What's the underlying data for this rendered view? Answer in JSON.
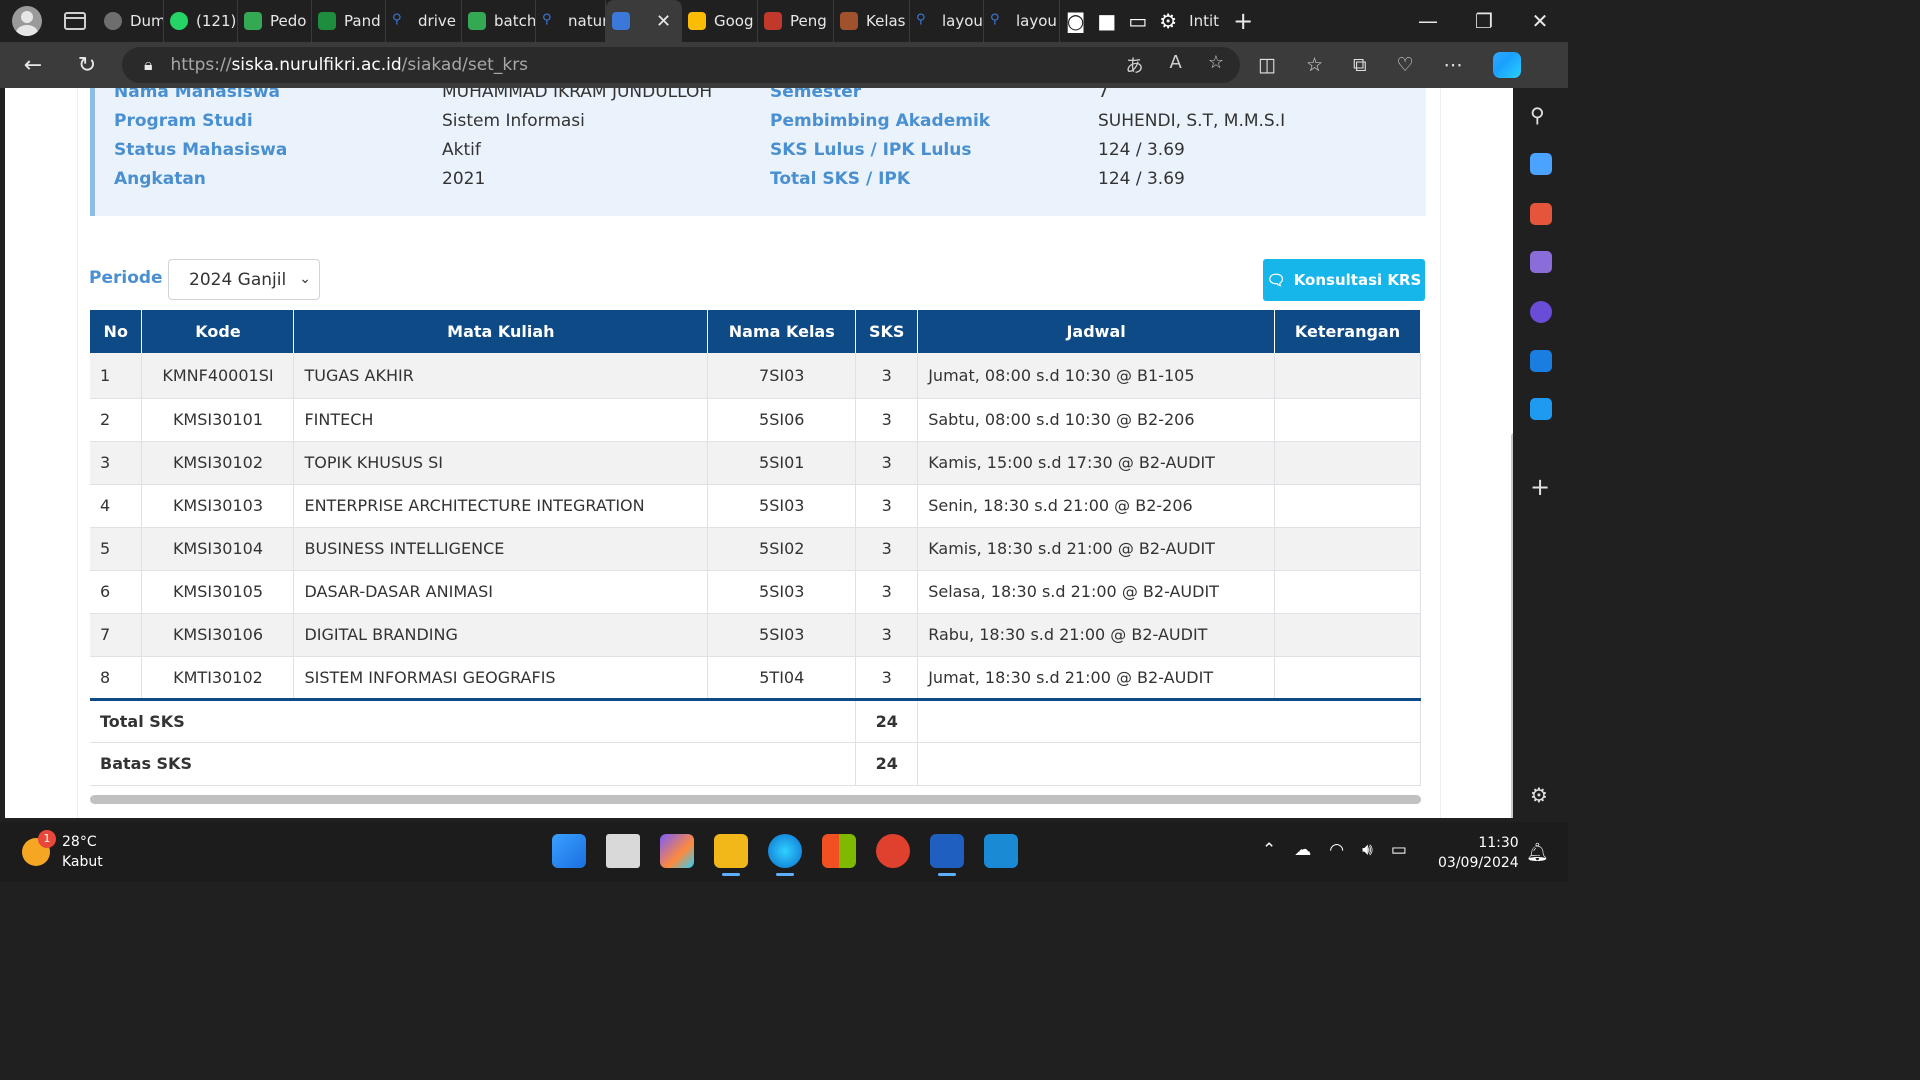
{
  "browser": {
    "tabs": [
      {
        "label": "Dum",
        "color": "#6e6e6e"
      },
      {
        "label": "(121)",
        "color": "#25d366"
      },
      {
        "label": "Pedo",
        "color": "#34a853"
      },
      {
        "label": "Pand",
        "color": "#1e8e3e"
      },
      {
        "label": "drive",
        "color": "#3c78d8"
      },
      {
        "label": "batch",
        "color": "#34a853"
      },
      {
        "label": "natur",
        "color": "#3c78d8"
      }
    ],
    "active_tab": {
      "label": "",
      "close": "✕"
    },
    "tabs_after": [
      {
        "label": "Goog",
        "color": "#fbbc05"
      },
      {
        "label": "Peng",
        "color": "#c0392b"
      },
      {
        "label": "Kelas",
        "color": "#a0522d"
      },
      {
        "label": "layou",
        "color": "#3c78d8"
      },
      {
        "label": "layou",
        "color": "#3c78d8"
      },
      {
        "label": "Intit",
        "color": "#888888"
      }
    ],
    "new_tab": "+",
    "url_prefix": "https://",
    "url_host": "siska.nurulfikri.ac.id",
    "url_path": "/siakad/set_krs"
  },
  "student": {
    "labels": {
      "name": "Nama Mahasiswa",
      "program": "Program Studi",
      "status": "Status Mahasiswa",
      "angkatan": "Angkatan",
      "semester": "Semester",
      "pembimbing": "Pembimbing Akademik",
      "sks_lulus": "SKS Lulus / IPK Lulus",
      "total_sks": "Total SKS / IPK"
    },
    "values": {
      "name": "MUHAMMAD IKRAM JUNDULLOH",
      "program": "Sistem Informasi",
      "status": "Aktif",
      "angkatan": "2021",
      "semester": "7",
      "pembimbing": "SUHENDI, S.T, M.M.S.I",
      "sks_lulus": "124 / 3.69",
      "total_sks": "124 / 3.69"
    }
  },
  "periode": {
    "label": "Periode",
    "selected": "2024 Ganjil"
  },
  "konsultasi_button": "Konsultasi KRS",
  "table": {
    "headers": [
      "No",
      "Kode",
      "Mata Kuliah",
      "Nama Kelas",
      "SKS",
      "Jadwal",
      "Keterangan"
    ],
    "rows": [
      {
        "no": "1",
        "kode": "KMNF40001SI",
        "mk": "TUGAS AKHIR",
        "kelas": "7SI03",
        "sks": "3",
        "jadwal": "Jumat, 08:00 s.d 10:30 @ B1-105",
        "ket": ""
      },
      {
        "no": "2",
        "kode": "KMSI30101",
        "mk": "FINTECH",
        "kelas": "5SI06",
        "sks": "3",
        "jadwal": "Sabtu, 08:00 s.d 10:30 @ B2-206",
        "ket": ""
      },
      {
        "no": "3",
        "kode": "KMSI30102",
        "mk": "TOPIK KHUSUS SI",
        "kelas": "5SI01",
        "sks": "3",
        "jadwal": "Kamis, 15:00 s.d 17:30 @ B2-AUDIT",
        "ket": ""
      },
      {
        "no": "4",
        "kode": "KMSI30103",
        "mk": "ENTERPRISE ARCHITECTURE INTEGRATION",
        "kelas": "5SI03",
        "sks": "3",
        "jadwal": "Senin, 18:30 s.d 21:00 @ B2-206",
        "ket": ""
      },
      {
        "no": "5",
        "kode": "KMSI30104",
        "mk": "BUSINESS INTELLIGENCE",
        "kelas": "5SI02",
        "sks": "3",
        "jadwal": "Kamis, 18:30 s.d 21:00 @ B2-AUDIT",
        "ket": ""
      },
      {
        "no": "6",
        "kode": "KMSI30105",
        "mk": "DASAR-DASAR ANIMASI",
        "kelas": "5SI03",
        "sks": "3",
        "jadwal": "Selasa, 18:30 s.d 21:00 @ B2-AUDIT",
        "ket": ""
      },
      {
        "no": "7",
        "kode": "KMSI30106",
        "mk": "DIGITAL BRANDING",
        "kelas": "5SI03",
        "sks": "3",
        "jadwal": "Rabu, 18:30 s.d 21:00 @ B2-AUDIT",
        "ket": ""
      },
      {
        "no": "8",
        "kode": "KMTI30102",
        "mk": "SISTEM INFORMASI GEOGRAFIS",
        "kelas": "5TI04",
        "sks": "3",
        "jadwal": "Jumat, 18:30 s.d 21:00 @ B2-AUDIT",
        "ket": ""
      }
    ],
    "total_label": "Total SKS",
    "total_value": "24",
    "batas_label": "Batas SKS",
    "batas_value": "24"
  },
  "taskbar": {
    "weather_temp": "28°C",
    "weather_desc": "Kabut",
    "weather_badge": "1",
    "time": "11:30",
    "date": "03/09/2024"
  },
  "colors": {
    "table_header": "#0d4a86",
    "button": "#16b6ea",
    "label_blue": "#4a8fd0"
  }
}
